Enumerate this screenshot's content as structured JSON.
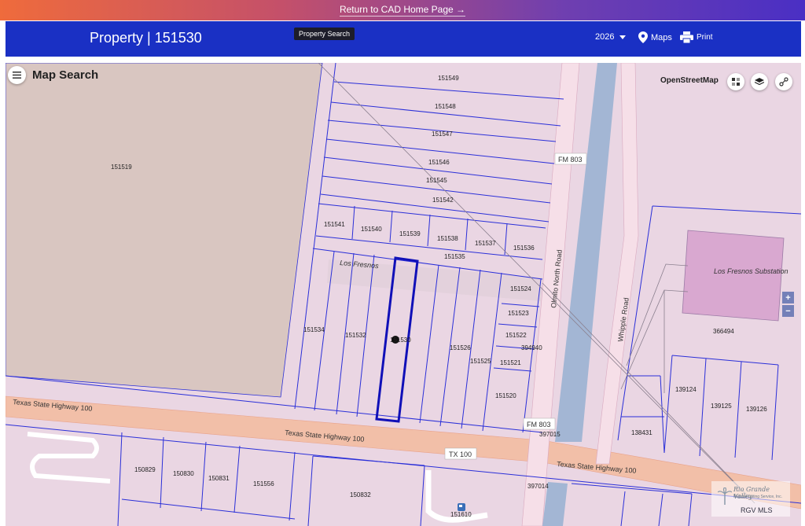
{
  "top_link": {
    "label": "Return to CAD Home Page",
    "arrow": "→"
  },
  "header": {
    "title": "Property | 151530",
    "year": "2026",
    "maps_label": "Maps",
    "print_label": "Print",
    "tooltip": "Property Search"
  },
  "map": {
    "title": "Map Search",
    "basemap": "OpenStreetMap",
    "zoom_in": "+",
    "zoom_out": "−",
    "selected_parcel": "151530",
    "parcels": {
      "p151549": "151549",
      "p151548": "151548",
      "p151547": "151547",
      "p151546": "151546",
      "p151545": "151545",
      "p151542": "151542",
      "p151541": "151541",
      "p151540": "151540",
      "p151539": "151539",
      "p151538": "151538",
      "p151537": "151537",
      "p151536": "151536",
      "p151535": "151535",
      "p151534": "151534",
      "p151532": "151532",
      "p151530": "151530",
      "p151526": "151526",
      "p151525": "151525",
      "p151524": "151524",
      "p151523": "151523",
      "p151522": "151522",
      "p151521": "151521",
      "p151520": "151520",
      "p394940": "394940",
      "p397015": "397015",
      "p397014": "397014",
      "p151519": "151519",
      "p366494": "366494",
      "p139124": "139124",
      "p139125": "139125",
      "p139126": "139126",
      "p138431": "138431",
      "p150829": "150829",
      "p150830": "150830",
      "p150831": "150831",
      "p151556": "151556",
      "p150832": "150832",
      "p151610": "151610"
    },
    "roads": {
      "fm803_a": "FM 803",
      "fm803_b": "FM 803",
      "olmito": "Olmito North Road",
      "whipple": "Whipple Road",
      "hwy100_a": "Texas State Highway 100",
      "hwy100_b": "Texas State Highway 100",
      "hwy100_c": "Texas State Highway 100",
      "tx100": "TX 100",
      "los_fresnos": "Los Fresnos",
      "substation": "Los Fresnos Substation"
    },
    "watermark": {
      "line1": "Rio Grande Valley",
      "line2": "Multiple Listing Service, Inc.",
      "line3": "RGV MLS"
    }
  },
  "colors": {
    "parcel_line": "#2a2fd8",
    "selected_outline": "#1010b8",
    "header_bg": "#1a30c4",
    "highway": "#f2bfa8",
    "canal": "#a3b6d4"
  }
}
